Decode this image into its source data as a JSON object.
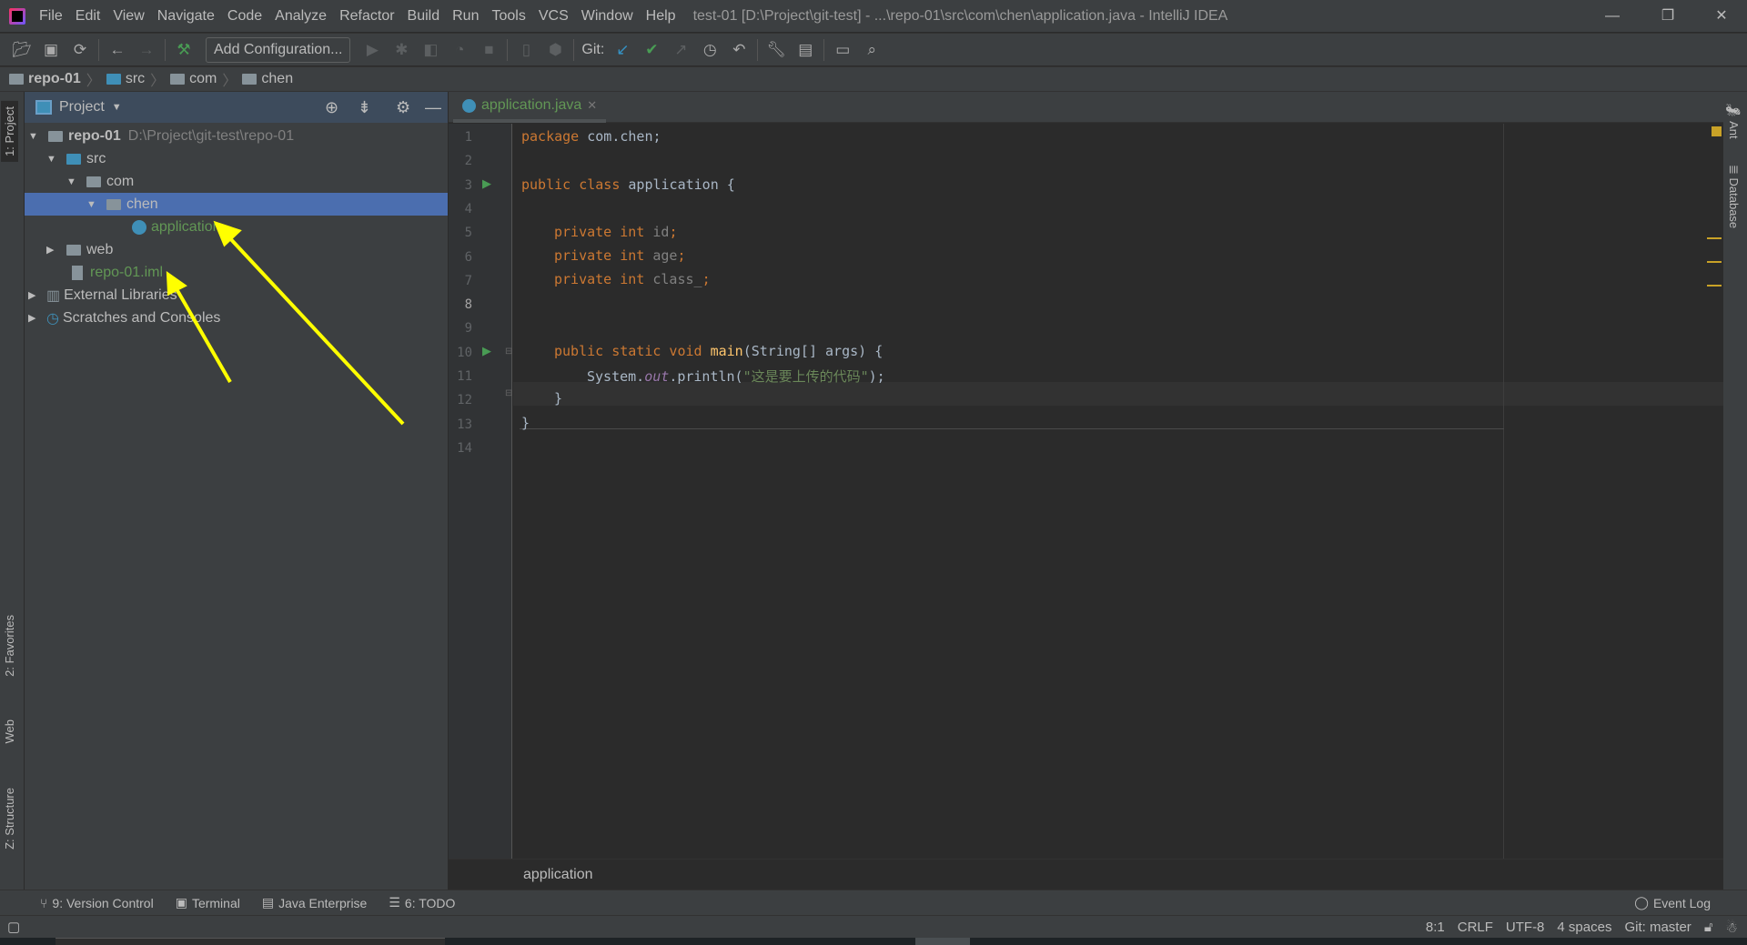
{
  "titlebar": {
    "app_icon": "intellij-icon",
    "menus": [
      "File",
      "Edit",
      "View",
      "Navigate",
      "Code",
      "Analyze",
      "Refactor",
      "Build",
      "Run",
      "Tools",
      "VCS",
      "Window",
      "Help"
    ],
    "title": "test-01 [D:\\Project\\git-test] - ...\\repo-01\\src\\com\\chen\\application.java - IntelliJ IDEA"
  },
  "toolbar": {
    "add_configuration": "Add Configuration...",
    "git_label": "Git:"
  },
  "breadcrumbs": [
    "repo-01",
    "src",
    "com",
    "chen"
  ],
  "left_stripe": {
    "project": "1: Project",
    "favorites": "2: Favorites",
    "web": "Web",
    "structure": "Z: Structure"
  },
  "right_stripe": {
    "ant": "Ant",
    "database": "Database"
  },
  "project_panel": {
    "title": "Project",
    "tree": [
      {
        "label": "repo-01",
        "path": "D:\\Project\\git-test\\repo-01"
      },
      {
        "label": "src"
      },
      {
        "label": "com"
      },
      {
        "label": "chen"
      },
      {
        "label": "application"
      },
      {
        "label": "web"
      },
      {
        "label": "repo-01.iml"
      },
      {
        "label": "External Libraries"
      },
      {
        "label": "Scratches and Consoles"
      }
    ]
  },
  "editor": {
    "tab": "application.java",
    "lines": [
      "1",
      "2",
      "3",
      "4",
      "5",
      "6",
      "7",
      "8",
      "9",
      "10",
      "11",
      "12",
      "13",
      "14"
    ],
    "code": {
      "l1a": "package",
      "l1b": " com.chen;",
      "l3a": "public class",
      "l3b": " application {",
      "priv": "private int",
      "f1": " id",
      "f2": " age",
      "f3": " class_",
      "semi": ";",
      "l10a": "public static void",
      "l10b": "main",
      "l10c": "(String[] args) {",
      "l11a": "System.",
      "l11b": "out",
      "l11c": ".println(",
      "l11d": "\"这是要上传的代码\"",
      "l11e": ");",
      "close": "}"
    },
    "breadcrumb": "application"
  },
  "bottom_tools": [
    "9: Version Control",
    "Terminal",
    "Java Enterprise",
    "6: TODO"
  ],
  "event_log": "Event Log",
  "status": {
    "position": "8:1",
    "line_sep": "CRLF",
    "encoding": "UTF-8",
    "indent": "4 spaces",
    "branch": "Git: master"
  },
  "colors": {
    "annotation_arrow": "#ffff00",
    "selection": "#4b6eaf",
    "keyword": "#cc7832",
    "string": "#6a8759"
  }
}
